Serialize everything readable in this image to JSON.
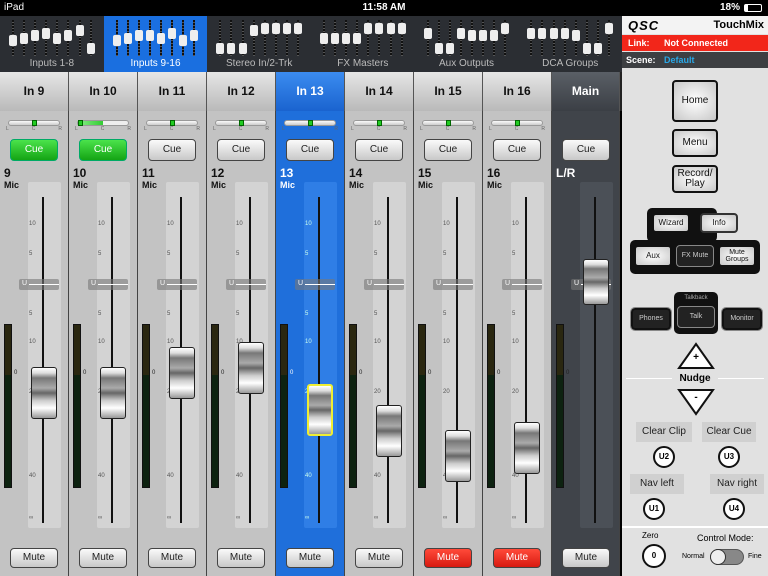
{
  "status": {
    "device": "iPad",
    "time": "11:58 AM",
    "battery": "18%",
    "battery_level": 0.18
  },
  "tabs": [
    {
      "label": "Inputs 1-8",
      "selected": false
    },
    {
      "label": "Inputs 9-16",
      "selected": true
    },
    {
      "label": "Stereo In/2-Trk",
      "selected": false
    },
    {
      "label": "FX Masters",
      "selected": false
    },
    {
      "label": "Aux Outputs",
      "selected": false
    },
    {
      "label": "DCA Groups",
      "selected": false
    }
  ],
  "scale": {
    "labels": [
      "10",
      "5",
      "5",
      "10",
      "20",
      "40",
      "∞"
    ],
    "unity": "U",
    "meter_zero": "0",
    "pan": [
      "L",
      "C",
      "R"
    ]
  },
  "channels": [
    {
      "header": "In 9",
      "number": "9",
      "source": "Mic",
      "cue_label": "Cue",
      "cue_on": true,
      "mute_label": "Mute",
      "mute_on": false,
      "fader_db": -20,
      "pan": 0
    },
    {
      "header": "In 10",
      "number": "10",
      "source": "Mic",
      "cue_label": "Cue",
      "cue_on": true,
      "mute_label": "Mute",
      "mute_on": false,
      "fader_db": -20,
      "pan": -100
    },
    {
      "header": "In 11",
      "number": "11",
      "source": "Mic",
      "cue_label": "Cue",
      "cue_on": false,
      "mute_label": "Mute",
      "mute_on": false,
      "fader_db": -16,
      "pan": 0
    },
    {
      "header": "In 12",
      "number": "12",
      "source": "Mic",
      "cue_label": "Cue",
      "cue_on": false,
      "mute_label": "Mute",
      "mute_on": false,
      "fader_db": -15,
      "pan": 0
    },
    {
      "header": "In 13",
      "number": "13",
      "source": "Mic",
      "cue_label": "Cue",
      "cue_on": false,
      "mute_label": "Mute",
      "mute_on": false,
      "fader_db": -24,
      "pan": 0,
      "selected": true
    },
    {
      "header": "In 14",
      "number": "14",
      "source": "Mic",
      "cue_label": "Cue",
      "cue_on": false,
      "mute_label": "Mute",
      "mute_on": false,
      "fader_db": -29,
      "pan": 0
    },
    {
      "header": "In 15",
      "number": "15",
      "source": "Mic",
      "cue_label": "Cue",
      "cue_on": false,
      "mute_label": "Mute",
      "mute_on": true,
      "fader_db": -35,
      "pan": 0
    },
    {
      "header": "In 16",
      "number": "16",
      "source": "Mic",
      "cue_label": "Cue",
      "cue_on": false,
      "mute_label": "Mute",
      "mute_on": true,
      "fader_db": -33,
      "pan": 0
    },
    {
      "header": "Main",
      "number": "L/R",
      "source": "",
      "cue_label": "Cue",
      "cue_on": false,
      "mute_label": "Mute",
      "mute_on": false,
      "fader_db": 0,
      "main": true
    }
  ],
  "panel": {
    "brand": "QSC",
    "product": "TouchMix",
    "link_label": "Link:",
    "link_value": "Not Connected",
    "scene_label": "Scene:",
    "scene_value": "Default",
    "home": "Home",
    "menu": "Menu",
    "record": "Record/ Play",
    "wizard": "Wizard",
    "info": "Info",
    "aux": "Aux",
    "fx_mute": "FX Mute",
    "mute_groups": "Mute Groups",
    "talkback": "Talkback",
    "phones": "Phones",
    "talk": "Talk",
    "monitor": "Monitor",
    "nudge": "Nudge",
    "nudge_up": "+",
    "nudge_down": "-",
    "clear_clip": "Clear Clip",
    "clear_cue": "Clear Cue",
    "nav_left": "Nav left",
    "nav_right": "Nav right",
    "u1": "U1",
    "u2": "U2",
    "u3": "U3",
    "u4": "U4",
    "zero_label": "Zero",
    "zero_btn": "0",
    "control_mode": "Control Mode:",
    "normal": "Normal",
    "fine": "Fine",
    "control_mode_value": "Normal"
  },
  "colors": {
    "accent": "#1a6fe0",
    "cue_on": "#22c022",
    "mute_on": "#e8241a",
    "link_bg": "#f2261a",
    "scene_text": "#2aa7e6"
  }
}
